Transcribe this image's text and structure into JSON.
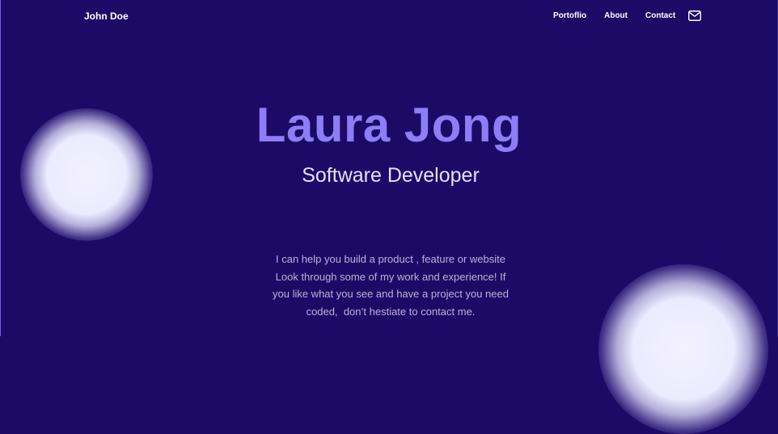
{
  "navbar": {
    "brand": "John Doe",
    "links": [
      "Portoflio",
      "About",
      "Contact"
    ],
    "mail_icon": "mail-icon"
  },
  "hero": {
    "name": "Laura Jong",
    "role": "Software Developer",
    "intro_lines": [
      "I can help you build a product , feature or website",
      "Look through some of my work and experience! If",
      "you like what you see and have a project you need",
      "coded,  don’t hestiate to contact me."
    ]
  },
  "colors": {
    "background": "#1c0b66",
    "accent": "#8d7ef7",
    "role_text": "#e4e0ff",
    "body_text": "#b8b3d6",
    "orb": "#ecebff"
  }
}
